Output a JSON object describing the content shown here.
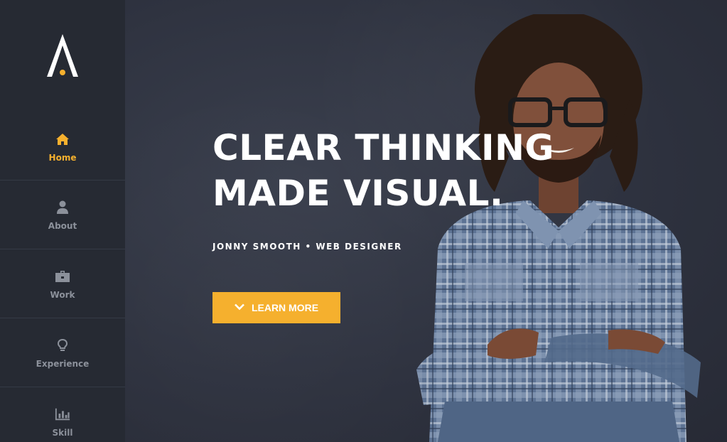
{
  "logo": {
    "letter": "A",
    "accent_color": "#f5b02e"
  },
  "sidebar": {
    "items": [
      {
        "label": "Home",
        "icon": "home-icon",
        "active": true
      },
      {
        "label": "About",
        "icon": "user-icon",
        "active": false
      },
      {
        "label": "Work",
        "icon": "briefcase-icon",
        "active": false
      },
      {
        "label": "Experience",
        "icon": "lightbulb-icon",
        "active": false
      },
      {
        "label": "Skill",
        "icon": "bar-chart-icon",
        "active": false
      }
    ]
  },
  "hero": {
    "headline_line1": "CLEAR THINKING",
    "headline_line2": "MADE VISUAL.",
    "subline": "JONNY SMOOTH • WEB DESIGNER",
    "cta_label": "LEARN MORE"
  },
  "colors": {
    "accent": "#f5b02e",
    "sidebar_bg": "#262a33",
    "hero_bg": "#2e323f"
  }
}
